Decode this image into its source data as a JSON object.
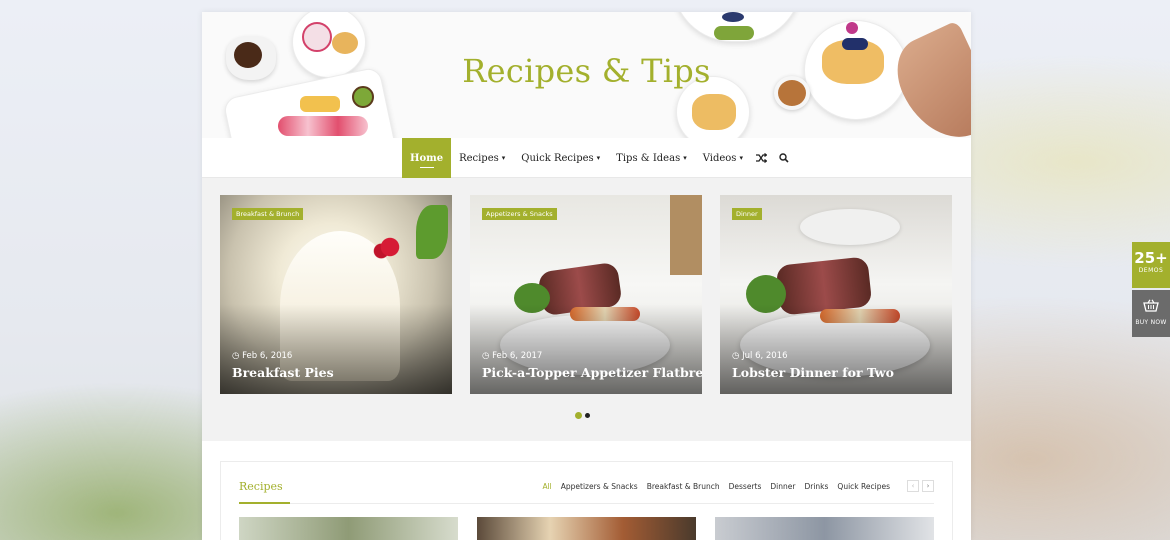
{
  "header": {
    "site_title": "Recipes & Tips"
  },
  "nav": {
    "items": [
      {
        "label": "Home",
        "active": true
      },
      {
        "label": "Recipes",
        "caret": "▾"
      },
      {
        "label": "Quick Recipes",
        "caret": "▾"
      },
      {
        "label": "Tips & Ideas",
        "caret": "▾"
      },
      {
        "label": "Videos",
        "caret": "▾"
      }
    ],
    "icons": [
      "shuffle-icon",
      "search-icon"
    ]
  },
  "slider": {
    "slides": [
      {
        "category": "Breakfast & Brunch",
        "date": "Feb 6, 2016",
        "title": "Breakfast Pies"
      },
      {
        "category": "Appetizers & Snacks",
        "date": "Feb 6, 2017",
        "title": "Pick-a-Topper Appetizer Flatbreads"
      },
      {
        "category": "Dinner",
        "date": "Jul 6, 2016",
        "title": "Lobster Dinner for Two"
      }
    ],
    "active_dot": 0,
    "dot_count": 2
  },
  "recipes": {
    "title": "Recipes",
    "filters": [
      "All",
      "Appetizers & Snacks",
      "Breakfast & Brunch",
      "Desserts",
      "Dinner",
      "Drinks",
      "Quick Recipes"
    ],
    "active_filter": "All",
    "prev": "‹",
    "next": "›"
  },
  "side_widget": {
    "demos_count": "25+",
    "demos_label": "DEMOS",
    "buy_label": "BUY NOW"
  },
  "colors": {
    "accent": "#a3b02d",
    "dark": "#222222"
  }
}
